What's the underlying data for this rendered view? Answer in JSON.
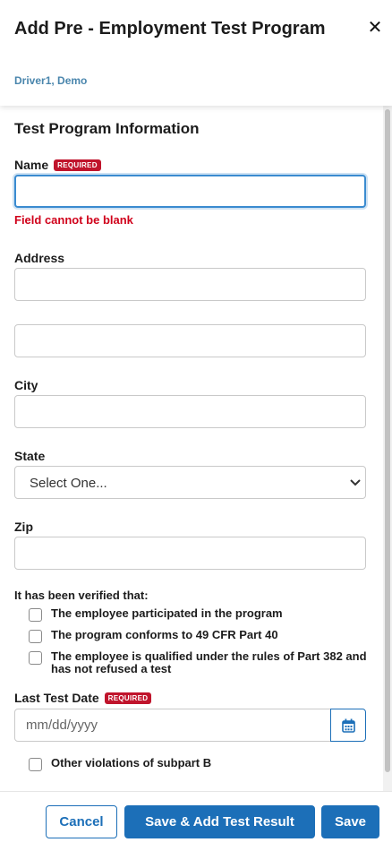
{
  "header": {
    "title": "Add Pre - Employment Test Program",
    "subtitle": "Driver1, Demo",
    "close_glyph": "✕"
  },
  "form": {
    "section_title": "Test Program Information",
    "required_badge": "REQUIRED",
    "name": {
      "label": "Name",
      "value": "",
      "error": "Field cannot be blank"
    },
    "address": {
      "label": "Address",
      "line1": "",
      "line2": ""
    },
    "city": {
      "label": "City",
      "value": ""
    },
    "state": {
      "label": "State",
      "selected": "Select One..."
    },
    "zip": {
      "label": "Zip",
      "value": ""
    },
    "verified": {
      "title": "It has been verified that:",
      "items": [
        {
          "label": "The employee participated in the program",
          "checked": false
        },
        {
          "label": "The program conforms to 49 CFR Part 40",
          "checked": false
        },
        {
          "label": "The employee is qualified under the rules of Part 382 and has not refused a test",
          "checked": false
        }
      ]
    },
    "last_test_date": {
      "label": "Last Test Date",
      "placeholder": "mm/dd/yyyy"
    },
    "other_violations": {
      "label": "Other violations of subpart B",
      "checked": false
    }
  },
  "footer": {
    "cancel_label": "Cancel",
    "save_add_label": "Save & Add Test Result",
    "save_label": "Save"
  },
  "colors": {
    "accent": "#1c6fb8",
    "required": "#c0142c",
    "error": "#d0021b",
    "subtitle": "#4a86ad"
  }
}
